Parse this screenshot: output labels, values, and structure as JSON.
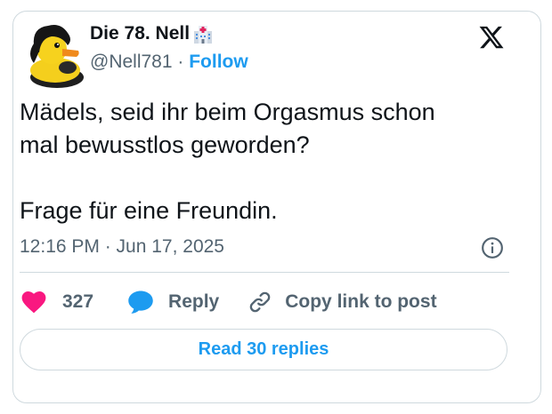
{
  "author": {
    "display_name": "Die 78. Nell",
    "emoji": "hospital-emoji",
    "handle": "@Nell781",
    "separator": "·",
    "follow_label": "Follow"
  },
  "brand": {
    "logo": "x-logo-icon"
  },
  "tweet": {
    "lines": [
      "Mädels, seid ihr beim Orgasmus schon",
      "mal bewusstlos geworden?",
      "Frage für eine Freundin."
    ],
    "timestamp": "12:16 PM · Jun 17, 2025"
  },
  "actions": {
    "like_count": "327",
    "reply_label": "Reply",
    "copy_link_label": "Copy link to post"
  },
  "read_replies_label": "Read 30 replies",
  "colors": {
    "accent": "#1d9bf0",
    "like": "#f91880",
    "text": "#0f1419",
    "muted": "#536471",
    "border": "#cfd9de"
  }
}
